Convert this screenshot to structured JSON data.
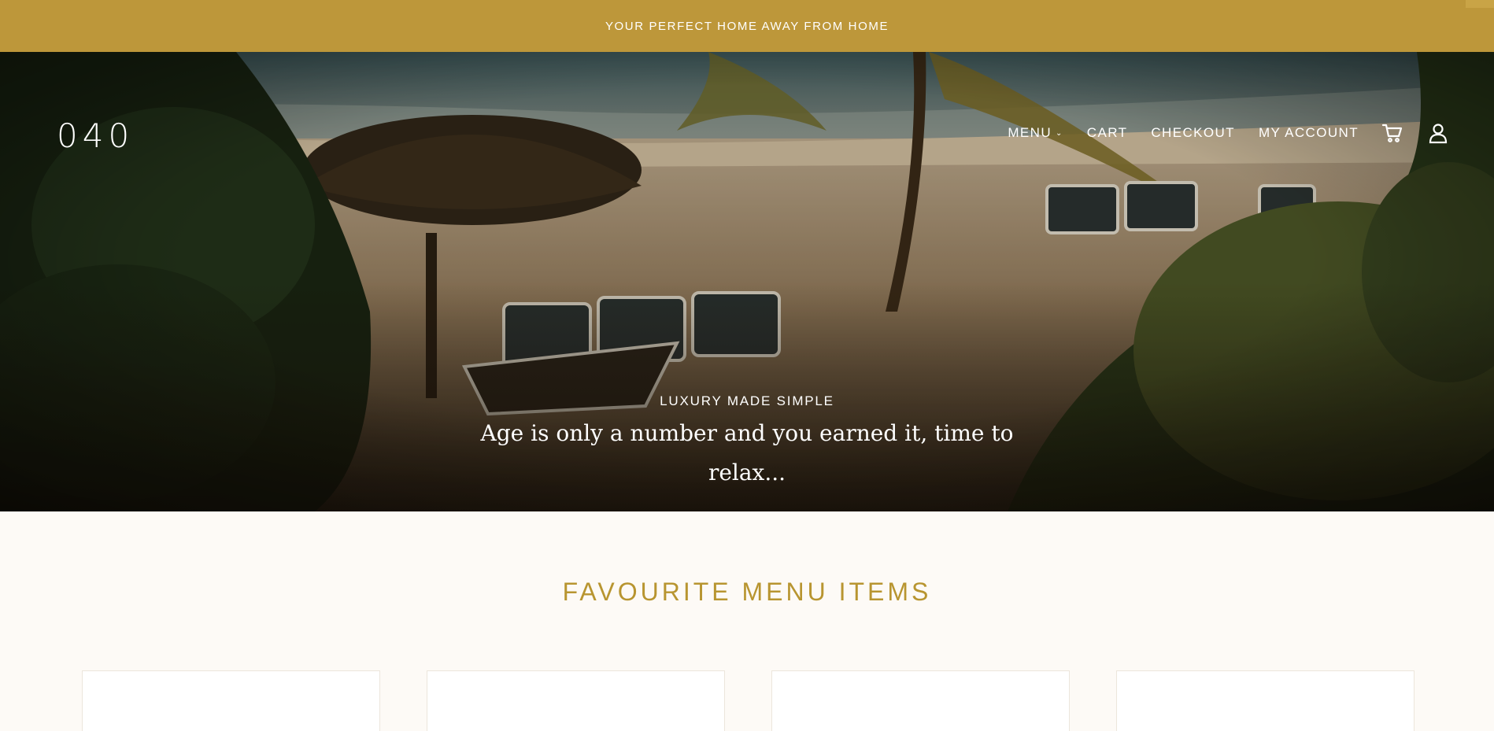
{
  "announcement": {
    "text": "YOUR PERFECT HOME AWAY FROM HOME"
  },
  "header": {
    "logo": "040",
    "nav": [
      {
        "label": "MENU",
        "has_dropdown": true
      },
      {
        "label": "CART"
      },
      {
        "label": "CHECKOUT"
      },
      {
        "label": "MY ACCOUNT"
      }
    ],
    "icons": [
      "cart-icon",
      "account-icon"
    ]
  },
  "hero": {
    "eyebrow": "LUXURY MADE SIMPLE",
    "headline_line1": "Age is only a number and you earned it, time to",
    "headline_line2": "relax..."
  },
  "favourites": {
    "title": "FAVOURITE MENU ITEMS",
    "cards": [
      "",
      "",
      "",
      ""
    ]
  },
  "colors": {
    "accent": "#bd973a",
    "title_gold": "#b89530",
    "page_bg": "#fdfaf6"
  }
}
